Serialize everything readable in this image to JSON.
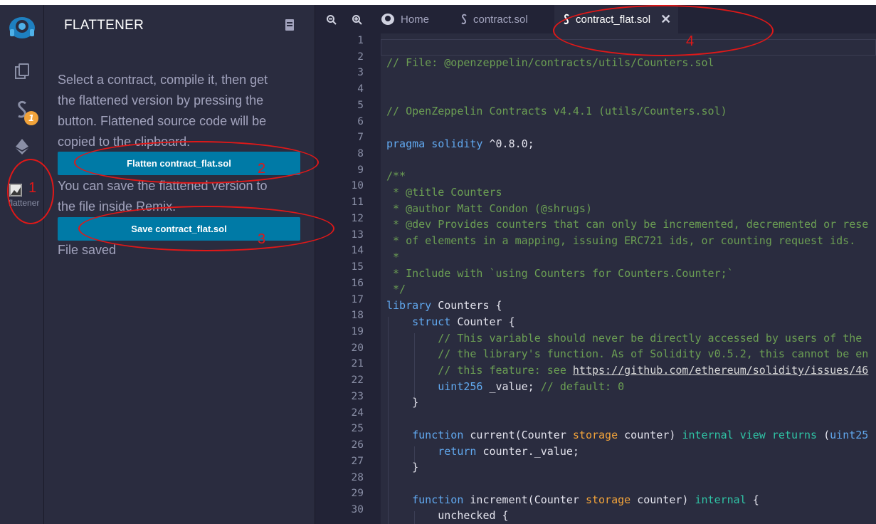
{
  "panel": {
    "title": "FLATTENER",
    "description_lines": [
      "Select a contract, compile it, then get",
      "the flattened version by pressing the",
      "button. Flattened source code will be",
      "copied to the clipboard."
    ],
    "flatten_button": "Flatten contract_flat.sol",
    "save_note_lines": [
      "You can save the flattened version to",
      "the file inside Remix."
    ],
    "save_button": "Save contract_flat.sol",
    "status": "File saved"
  },
  "rail": {
    "badge_count": "1",
    "plugin_label": "flattener"
  },
  "tabs": [
    {
      "label": "Home",
      "icon": "home-icon"
    },
    {
      "label": "contract.sol",
      "icon": "solidity-icon"
    },
    {
      "label": "contract_flat.sol",
      "icon": "solidity-icon",
      "active": true
    }
  ],
  "editor": {
    "line_numbers": [
      "1",
      "2",
      "3",
      "4",
      "5",
      "6",
      "7",
      "8",
      "9",
      "10",
      "11",
      "12",
      "13",
      "14",
      "15",
      "16",
      "17",
      "18",
      "19",
      "20",
      "21",
      "22",
      "23",
      "24",
      "25",
      "26",
      "27",
      "28",
      "29",
      "30"
    ]
  },
  "annotations": [
    "1",
    "2",
    "3",
    "4"
  ],
  "colors": {
    "accent_button": "#007aa6",
    "badge": "#f2a33a",
    "annotation": "#e01818",
    "comment": "#6b9e53",
    "keyword": "#61a9f0"
  }
}
